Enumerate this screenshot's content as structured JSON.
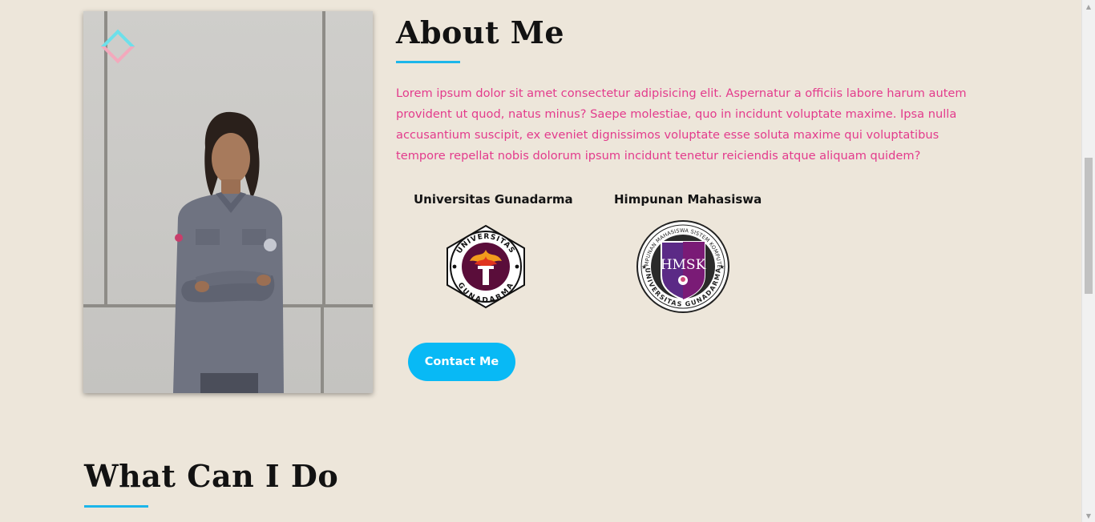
{
  "about": {
    "title": "About Me",
    "description": "Lorem ipsum dolor sit amet consectetur adipisicing elit. Aspernatur a officiis labore harum autem provident ut quod, natus minus? Saepe molestiae, quo in incidunt voluptate maxime. Ipsa nulla accusantium suscipit, ex eveniet dignissimos voluptate esse soluta maxime qui voluptatibus tempore repellat nobis dolorum ipsum incidunt tenetur reiciendis atque aliquam quidem?"
  },
  "organizations": [
    {
      "label": "Universitas Gunadarma",
      "logo": "universitas-gunadarma-logo",
      "logo_ring_text": "UNIVERSITAS",
      "logo_bottom_text": "GUNADARMA"
    },
    {
      "label": "Himpunan Mahasiswa",
      "logo": "hmsk-logo",
      "logo_ring_text": "HIMPUNAN MAHASISWA SISTEM KOMPUTER",
      "logo_bottom_text": "UNIVERSITAS GUNADARMA",
      "logo_shield_text": "HMSK"
    }
  ],
  "contact_button": {
    "label": "Contact Me"
  },
  "next_section": {
    "title": "What Can I Do"
  },
  "colors": {
    "background": "#ede6da",
    "accent": "#1cb6ea",
    "button": "#08b9f5",
    "body_text": "#e33b8c",
    "heading": "#121212"
  }
}
